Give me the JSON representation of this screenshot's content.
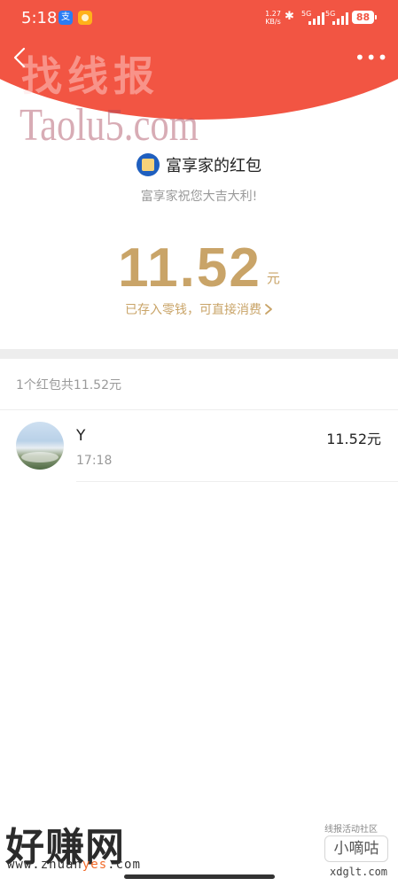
{
  "status_bar": {
    "time": "5:18",
    "app_icon_1": "支",
    "net_speed": "1.27 KB/s",
    "signal_1": "5G",
    "signal_2": "5G",
    "battery": "88"
  },
  "nav": {
    "more_label": "•••"
  },
  "watermarks": {
    "top_cn": "找线报",
    "top_en": "Taolu5.com",
    "bottom_left_cn": "好赚网",
    "bottom_left_url_a": "www.zhuan",
    "bottom_left_url_b": "yes",
    "bottom_left_url_c": ".com",
    "bottom_right_small": "线报活动社区",
    "bottom_right_box": "小嘀咕",
    "bottom_right_url": "xdglt.com"
  },
  "envelope": {
    "sender_name": "富享家的红包",
    "wish": "富享家祝您大吉大利!",
    "amount": "11.52",
    "unit": "元",
    "saved_text": "已存入零钱，可直接消费"
  },
  "records": {
    "summary": "1个红包共11.52元",
    "items": [
      {
        "name": "Y",
        "time": "17:18",
        "amount": "11.52元"
      }
    ]
  },
  "colors": {
    "header_red": "#f25543",
    "gold": "#c9a468"
  },
  "icons": [
    "back-arrow-icon",
    "more-dots-icon",
    "bluetooth-icon",
    "signal-icon",
    "battery-icon",
    "chevron-right-icon",
    "sender-logo-icon"
  ]
}
